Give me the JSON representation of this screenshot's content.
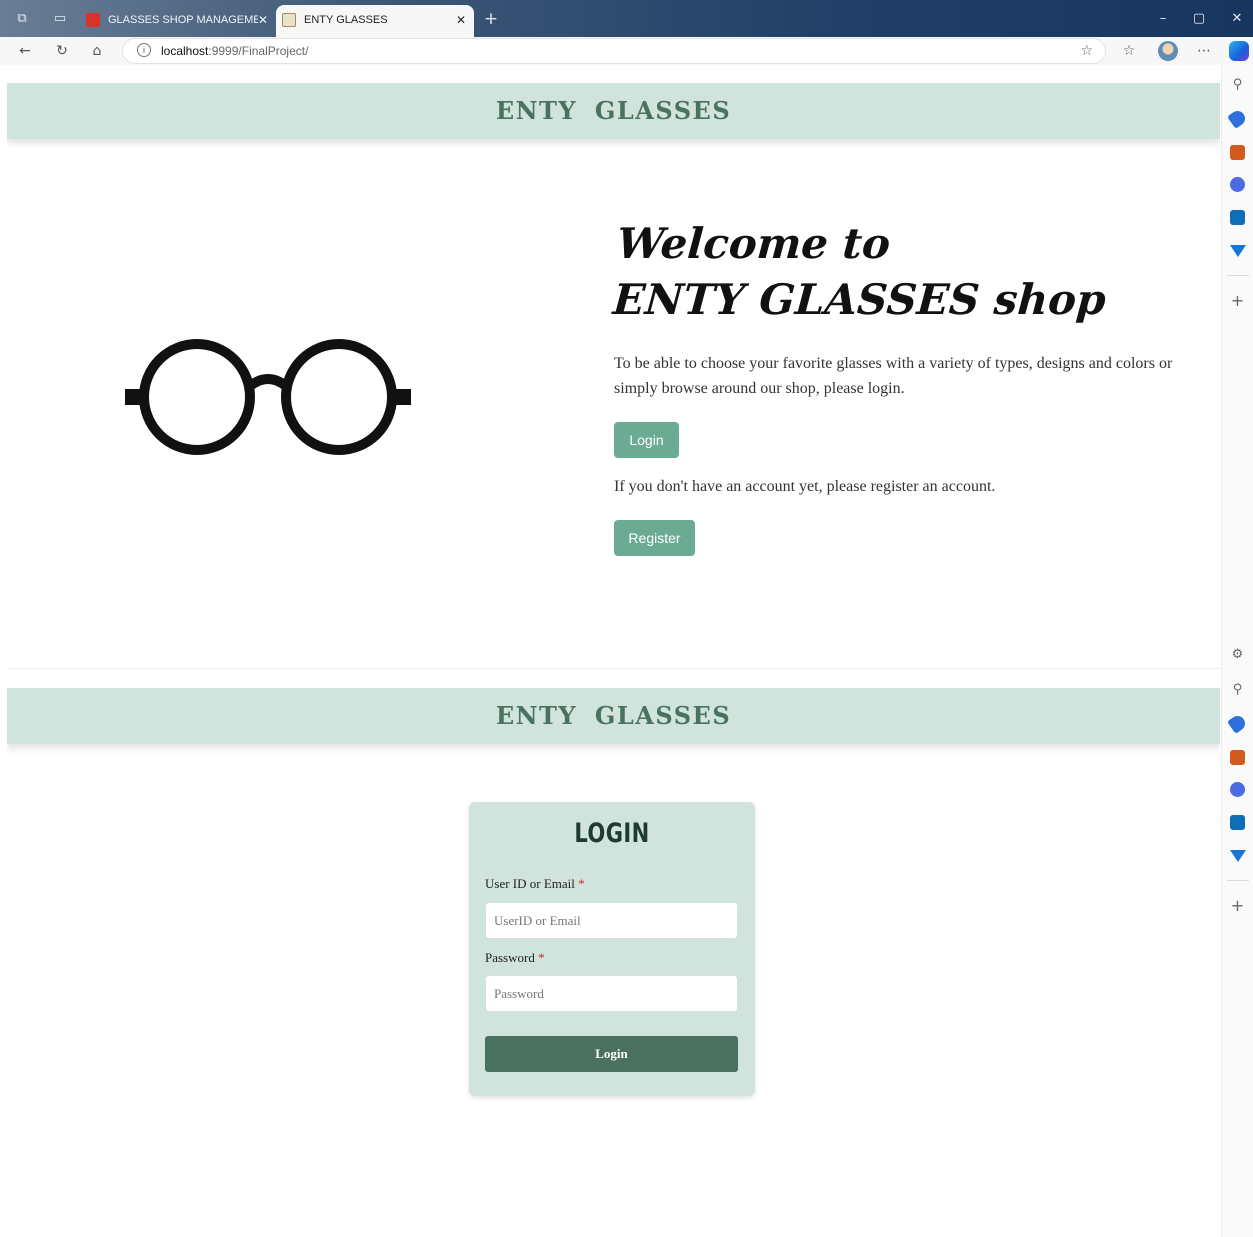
{
  "browser": {
    "tabs": [
      {
        "title": "GLASSES SHOP MANAGEMENT.p",
        "active": false
      },
      {
        "title": "ENTY GLASSES",
        "active": true
      }
    ],
    "url_host": "localhost",
    "url_path": ":9999/FinalProject/"
  },
  "site": {
    "brand": "ENTY  GLASSES"
  },
  "welcome": {
    "title_line1": "Welcome to",
    "title_line2": "ENTY GLASSES shop",
    "intro": "To be able to choose your favorite glasses with a variety of types, designs and colors or simply browse around our shop, please login.",
    "login_label": "Login",
    "register_prompt": "If you don't have an account yet, please register an account.",
    "register_label": "Register"
  },
  "login_form": {
    "title": "LOGIN",
    "user_label": "User ID or Email",
    "user_placeholder": "UserID or Email",
    "password_label": "Password",
    "password_placeholder": "Password",
    "required_mark": "*",
    "submit_label": "Login"
  },
  "icons": {
    "glasses": "round-glasses-image",
    "side_rail": [
      "search-icon",
      "tag-icon",
      "shopping-bag-icon",
      "copilot-hex-icon",
      "outlook-icon",
      "send-icon",
      "add-icon",
      "settings-icon"
    ]
  },
  "colors": {
    "header_bg": "#d0e3dc",
    "brand_text": "#4a735f",
    "button_green": "#6cab93",
    "submit_dark": "#4a7060",
    "required_red": "#d42a2a"
  }
}
